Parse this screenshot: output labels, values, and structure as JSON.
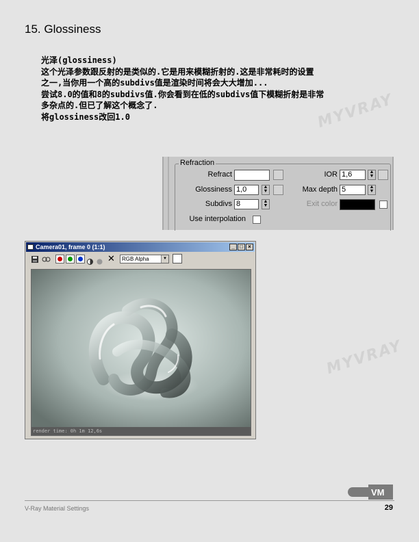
{
  "page": {
    "title": "15. Glossiness",
    "body_lines": [
      "光泽(glossiness)",
      "这个光泽参数跟反射的是类似的.它是用来模糊折射的.这是非常耗时的设置",
      "之一,当你用一个高的subdivs值是渲染时间将会大大增加...",
      "尝试8.0的值和8的subdivs值.你会看到在低的subdivs值下模糊折射是非常",
      "多杂点的.但已了解这个概念了.",
      "将glossiness改回1.0"
    ],
    "watermark": "MYVRAY",
    "footer_left": "V-Ray Material Settings",
    "page_number": "29",
    "logo_text": "VM"
  },
  "refraction_panel": {
    "group_label": "Refraction",
    "refract_label": "Refract",
    "refract_color": "#ffffff",
    "ior_label": "IOR",
    "ior_value": "1,6",
    "glossiness_label": "Glossiness",
    "glossiness_value": "1,0",
    "max_depth_label": "Max depth",
    "max_depth_value": "5",
    "subdivs_label": "Subdivs",
    "subdivs_value": "8",
    "exit_color_label": "Exit color",
    "exit_color": "#000000",
    "use_interpolation_label": "Use interpolation",
    "use_interpolation_checked": false
  },
  "render_window": {
    "title": "Camera01, frame 0 (1:1)",
    "channel_select": "RGB Alpha",
    "status": "render time: 0h 1m 12,6s",
    "channel_colors": [
      "#cc0000",
      "#009900",
      "#0033cc"
    ]
  }
}
